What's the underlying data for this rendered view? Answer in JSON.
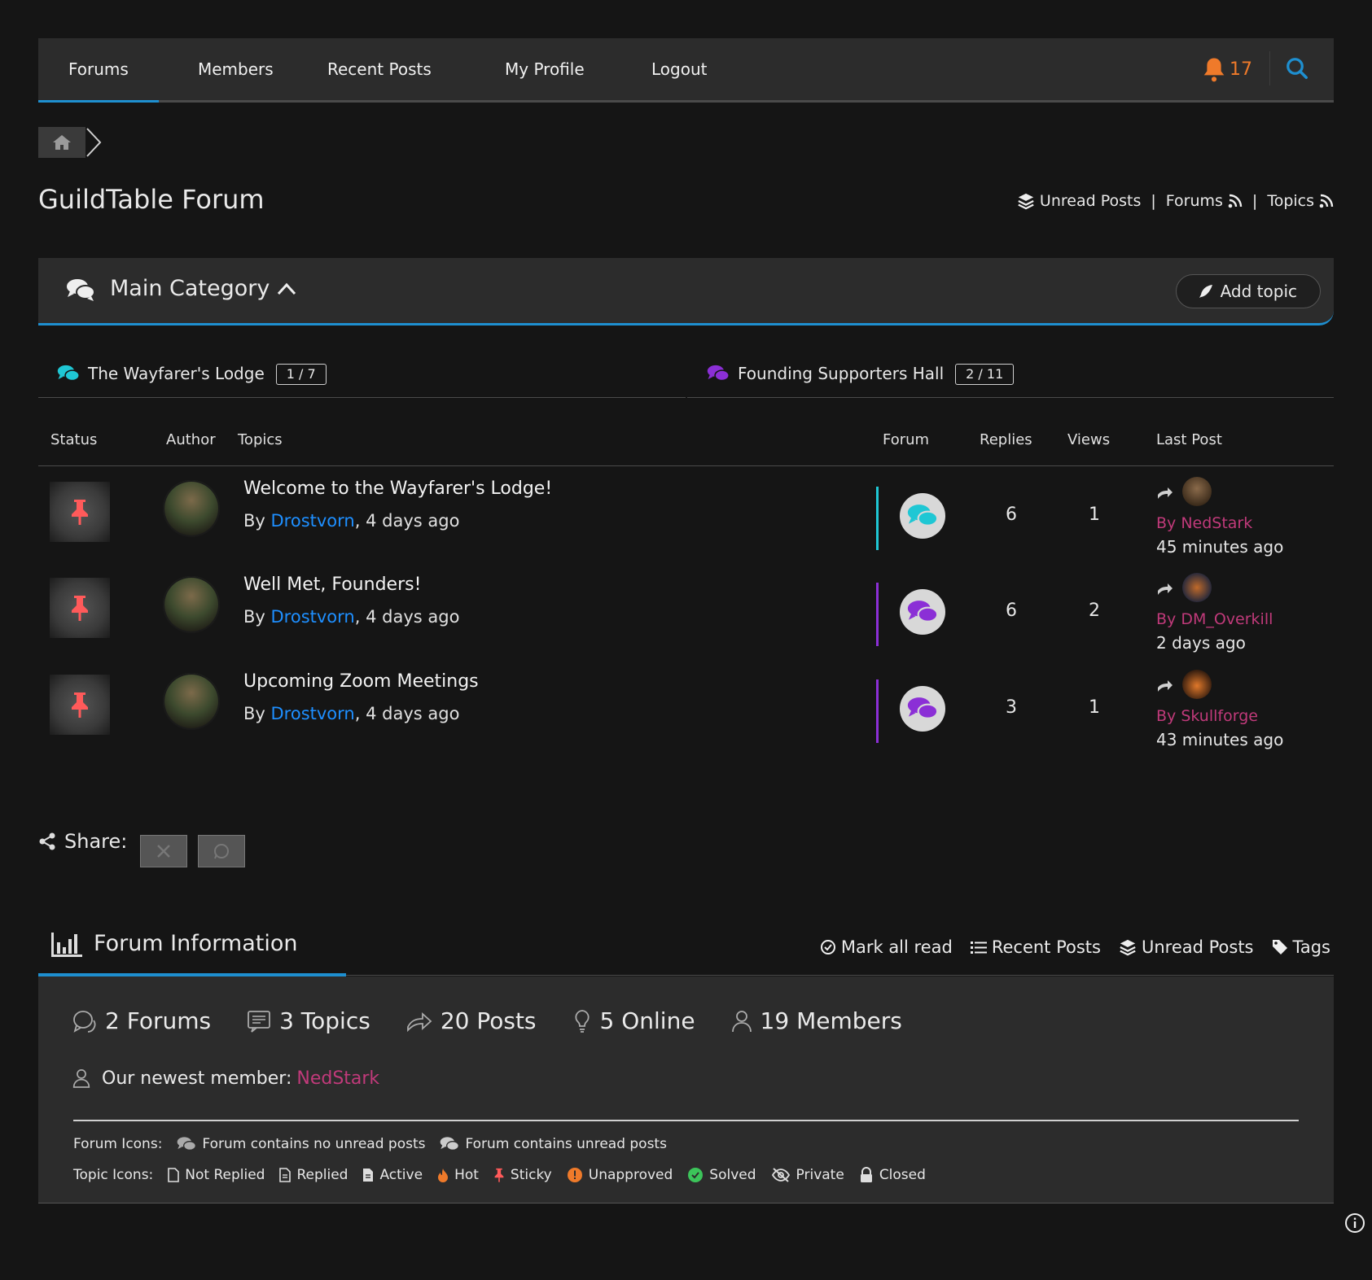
{
  "nav": {
    "items": [
      "Forums",
      "Members",
      "Recent Posts",
      "My Profile",
      "Logout"
    ],
    "notifications": "17"
  },
  "page": {
    "title": "GuildTable Forum",
    "links": {
      "unread": "Unread Posts",
      "forums": "Forums",
      "topics": "Topics"
    }
  },
  "category": {
    "title": "Main Category",
    "add_topic": "Add topic"
  },
  "subforums": [
    {
      "name": "The Wayfarer's Lodge",
      "count": "1 / 7",
      "color": "#1fc7d4"
    },
    {
      "name": "Founding Supporters Hall",
      "count": "2 / 11",
      "color": "#8b2fd6"
    }
  ],
  "table": {
    "headers": {
      "status": "Status",
      "author": "Author",
      "topics": "Topics",
      "forum": "Forum",
      "replies": "Replies",
      "views": "Views",
      "last": "Last Post"
    },
    "rows": [
      {
        "title": "Welcome to the Wayfarer's Lodge!",
        "by_prefix": "By ",
        "author": "Drostvorn",
        "time": ", 4 days ago",
        "replies": "6",
        "views": "1",
        "last_by": "By NedStark",
        "last_time": "45 minutes ago",
        "forum_color": "#1fc7d4"
      },
      {
        "title": "Well Met, Founders!",
        "by_prefix": "By ",
        "author": "Drostvorn",
        "time": ", 4 days ago",
        "replies": "6",
        "views": "2",
        "last_by": "By DM_Overkill",
        "last_time": "2 days ago",
        "forum_color": "#8b2fd6"
      },
      {
        "title": "Upcoming Zoom Meetings",
        "by_prefix": "By ",
        "author": "Drostvorn",
        "time": ", 4 days ago",
        "replies": "3",
        "views": "1",
        "last_by": "By Skullforge",
        "last_time": "43 minutes ago",
        "forum_color": "#8b2fd6"
      }
    ]
  },
  "share": {
    "label": "Share:"
  },
  "forum_info": {
    "title": "Forum Information",
    "links": [
      "Mark all read",
      "Recent Posts",
      "Unread Posts",
      "Tags"
    ],
    "stats": [
      "2 Forums",
      "3 Topics",
      "20 Posts",
      "5 Online",
      "19 Members"
    ],
    "newest_label": "Our newest member:",
    "newest_name": "NedStark",
    "forum_icons_label": "Forum Icons:",
    "forum_icons": [
      "Forum contains no unread posts",
      "Forum contains unread posts"
    ],
    "topic_icons_label": "Topic Icons:",
    "topic_icons": [
      "Not Replied",
      "Replied",
      "Active",
      "Hot",
      "Sticky",
      "Unapproved",
      "Solved",
      "Private",
      "Closed"
    ]
  },
  "colors": {
    "accent": "#1e8fd0",
    "link": "#1e8fff",
    "member": "#c03a7a",
    "bell": "#ef7a2a",
    "sticky": "#ff5a5a"
  }
}
